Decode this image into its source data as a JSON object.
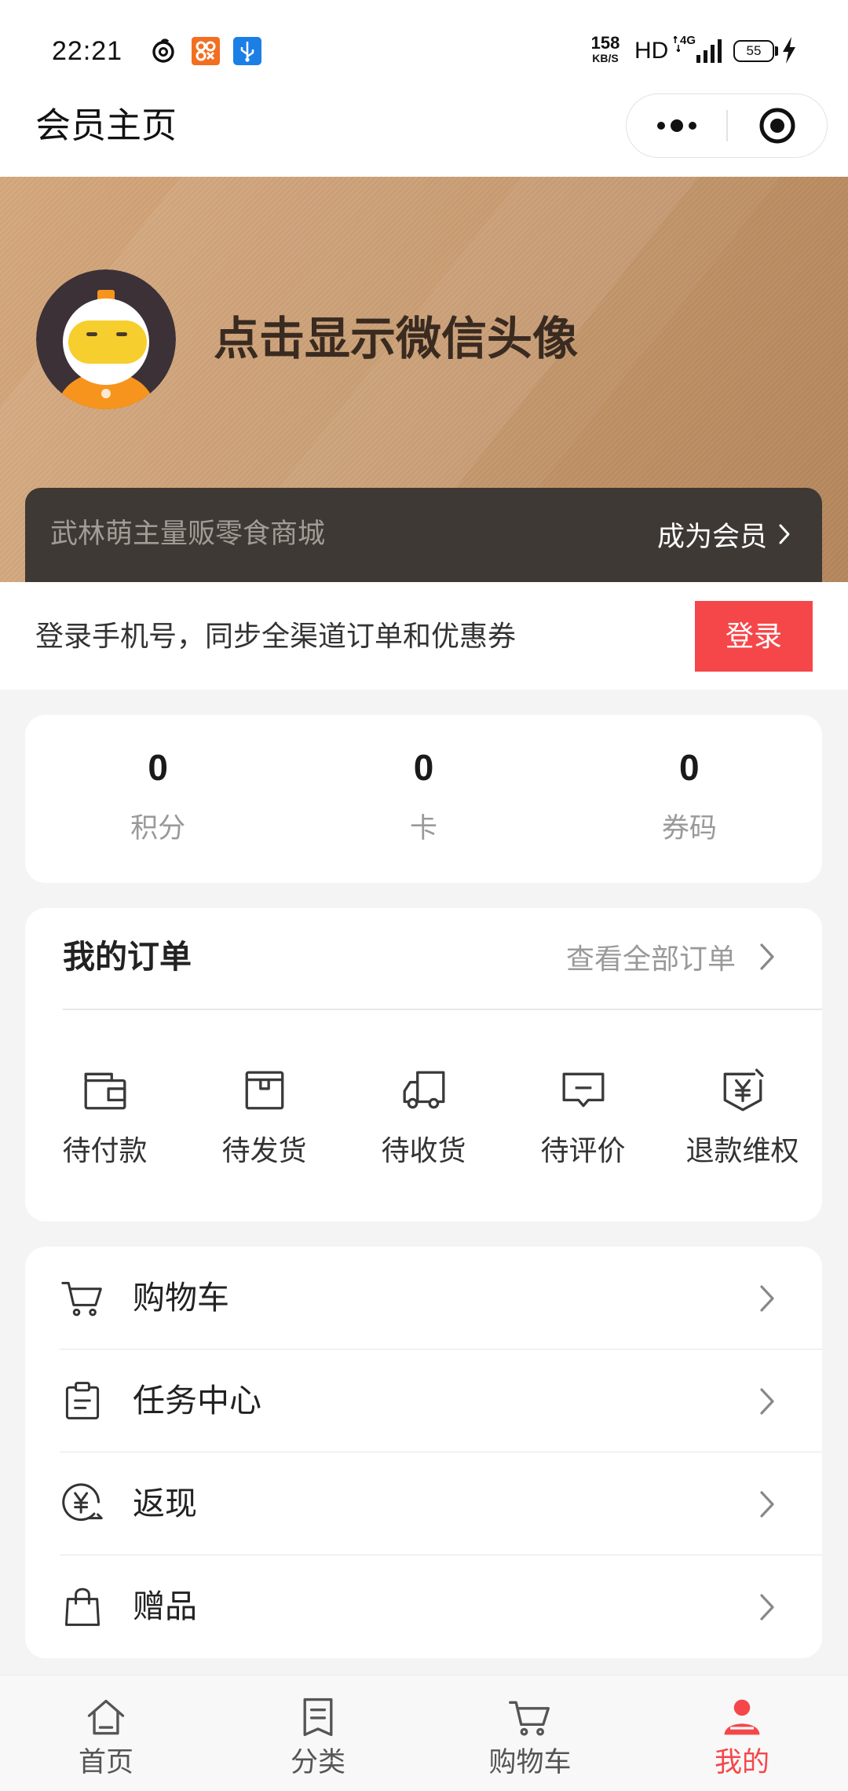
{
  "theme": {
    "accent": "#f5474a",
    "inactive_tab": "#555555",
    "banner_light": "#d6a97e",
    "banner_dark": "#b5875d",
    "member_bar": "#3e3935"
  },
  "status_bar": {
    "time": "22:21",
    "speed_value": "158",
    "speed_unit": "KB/S",
    "hd": "HD",
    "network": "4G",
    "battery": "55",
    "icons": [
      "netease-music-icon",
      "app-notification-icon",
      "usb-icon",
      "signal-icon",
      "charging-icon"
    ]
  },
  "nav": {
    "title": "会员主页",
    "icons": [
      "more-icon",
      "close-target-icon"
    ]
  },
  "profile": {
    "prompt": "点击显示微信头像"
  },
  "member_bar": {
    "shop_name": "武林萌主量贩零食商城",
    "join_label": "成为会员"
  },
  "login": {
    "hint": "登录手机号，同步全渠道订单和优惠券",
    "button": "登录"
  },
  "stats": [
    {
      "value": "0",
      "label": "积分"
    },
    {
      "value": "0",
      "label": "卡"
    },
    {
      "value": "0",
      "label": "券码"
    }
  ],
  "orders": {
    "title": "我的订单",
    "view_all": "查看全部订单",
    "items": [
      {
        "label": "待付款",
        "icon": "wallet-icon"
      },
      {
        "label": "待发货",
        "icon": "box-icon"
      },
      {
        "label": "待收货",
        "icon": "truck-icon"
      },
      {
        "label": "待评价",
        "icon": "comment-icon"
      },
      {
        "label": "退款维权",
        "icon": "refund-shield-icon"
      }
    ]
  },
  "menu": [
    {
      "label": "购物车",
      "icon": "cart-icon"
    },
    {
      "label": "任务中心",
      "icon": "clipboard-icon"
    },
    {
      "label": "返现",
      "icon": "cashback-icon"
    },
    {
      "label": "赠品",
      "icon": "gift-bag-icon"
    }
  ],
  "tabbar": {
    "items": [
      {
        "label": "首页",
        "icon": "home-icon",
        "active": false
      },
      {
        "label": "分类",
        "icon": "category-icon",
        "active": false
      },
      {
        "label": "购物车",
        "icon": "cart-icon",
        "active": false
      },
      {
        "label": "我的",
        "icon": "user-icon",
        "active": true
      }
    ]
  }
}
